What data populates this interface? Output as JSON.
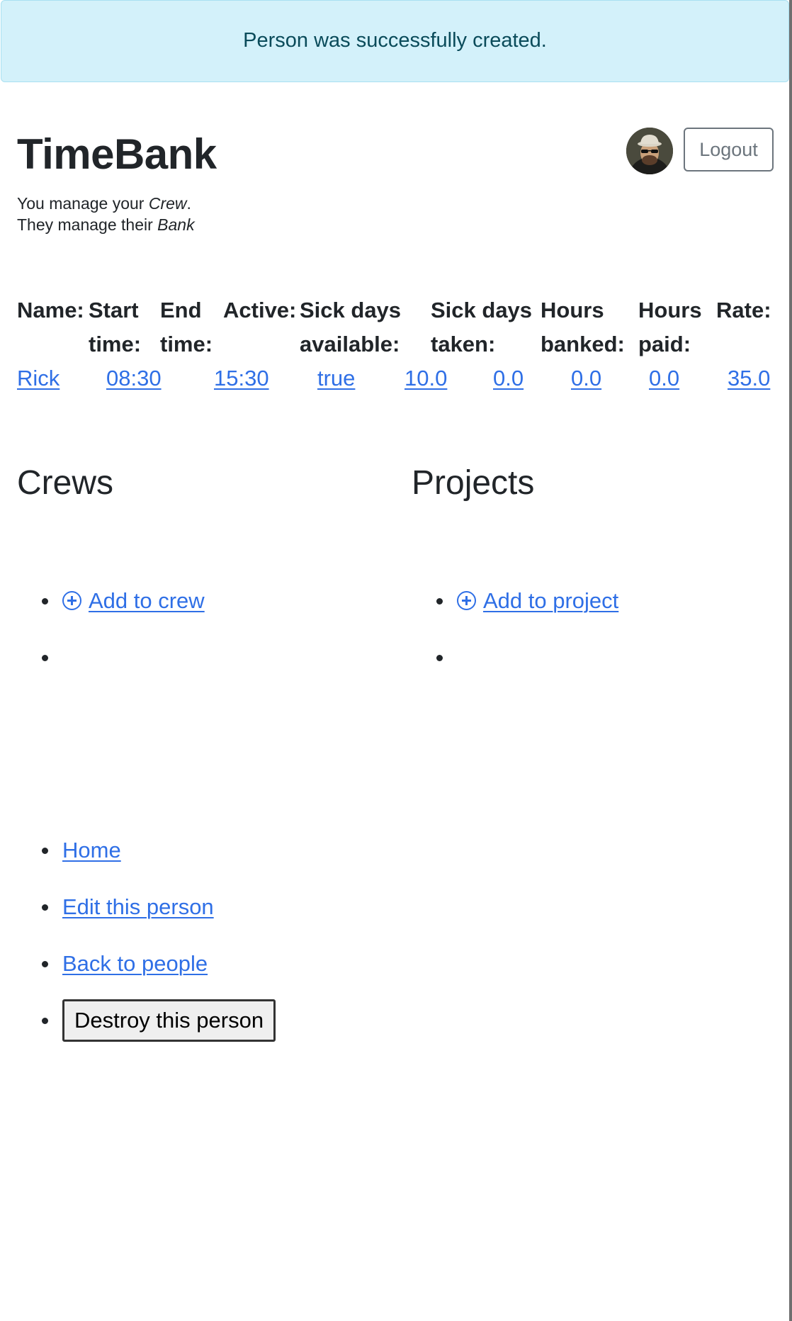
{
  "flash": {
    "message": "Person was successfully created."
  },
  "header": {
    "title": "TimeBank",
    "tagline_line1_prefix": "You manage your ",
    "tagline_line1_em": "Crew",
    "tagline_line1_suffix": ".",
    "tagline_line2_prefix": "They manage their ",
    "tagline_line2_em": "Bank",
    "logout_label": "Logout"
  },
  "person_table": {
    "headers": [
      [
        "Name:",
        ""
      ],
      [
        "Start",
        "time:"
      ],
      [
        "End",
        "time:"
      ],
      [
        "Active:",
        ""
      ],
      [
        "Sick days",
        "available:"
      ],
      [
        "Sick days",
        "taken:"
      ],
      [
        "Hours",
        "banked:"
      ],
      [
        "Hours",
        "paid:"
      ],
      [
        "Rate:",
        ""
      ]
    ],
    "row": {
      "name": "Rick",
      "start_time": "08:30",
      "end_time": "15:30",
      "active": "true",
      "sick_days_available": "10.0",
      "sick_days_taken": "0.0",
      "hours_banked": "0.0",
      "hours_paid": "0.0",
      "rate": "35.0"
    }
  },
  "crews": {
    "title": "Crews",
    "add_label": "Add to crew"
  },
  "projects": {
    "title": "Projects",
    "add_label": "Add to project"
  },
  "actions": {
    "home": "Home",
    "edit": "Edit this person",
    "back": "Back to people",
    "destroy": "Destroy this person"
  },
  "icons": {
    "add": "plus-circle-icon"
  },
  "colors": {
    "link": "#2f6fe6",
    "flash_bg": "#d3f1fa",
    "flash_text": "#0a4b5a",
    "text": "#212529"
  }
}
